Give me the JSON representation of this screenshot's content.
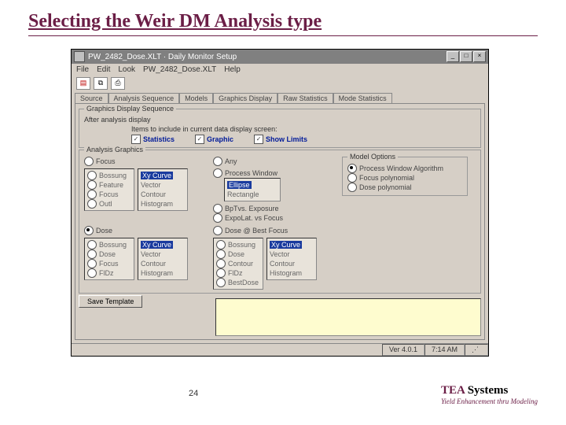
{
  "slide": {
    "title": "Selecting the Weir DM Analysis type",
    "page_number": "24"
  },
  "branding": {
    "company_tea": "TEA",
    "company_sys": " Systems",
    "tagline": "Yield Enhancement thru Modeling"
  },
  "window": {
    "title": "PW_2482_Dose.XLT · Daily Monitor Setup",
    "menu": {
      "file": "File",
      "edit": "Edit",
      "look": "Look",
      "doc": "PW_2482_Dose.XLT",
      "help": "Help"
    },
    "tabs": {
      "source": "Source",
      "analysis_sequence": "Analysis Sequence",
      "models": "Models",
      "graphics_display": "Graphics Display",
      "raw_statistics": "Raw Statistics",
      "mode_statistics": "Mode Statistics"
    },
    "gds": {
      "legend": "Graphics Display Sequence",
      "after_label": "After analysis display",
      "items_label": "Items to include in current data display screen:",
      "statistics": "Statistics",
      "graphic": "Graphic",
      "show_limits": "Show Limits"
    },
    "ag": {
      "legend": "Analysis Graphics",
      "focus": "Focus",
      "any": "Any",
      "list_bossung": "Bossung",
      "list_feature": "Feature",
      "list_focus": "Focus",
      "list_outl": "Outl",
      "vec_vector": "Vector",
      "vec_contour": "Contour",
      "vec_histogram": "Histogram",
      "xy_curve": "Xy Curve",
      "pw_label": "Process Window",
      "pw_ellipse": "Ellipse",
      "pw_rectangle": "Rectangle",
      "bp_label": "BpTvs. Exposure",
      "el_label": "ExpoLat. vs Focus",
      "model_legend": "Model Options",
      "model_pwa": "Process Window Algorithm",
      "model_fp": "Focus polynomial",
      "model_dp": "Dose polynomial",
      "dose": "Dose",
      "dose_best": "Dose @ Best Focus",
      "list2_bossung": "Bossung",
      "list2_dose": "Dose",
      "list2_focus": "Focus",
      "list2_fldz": "FlDz",
      "fl_bossung": "Bossung",
      "fl_dose": "Dose",
      "fl_contour": "Contour",
      "fl_fldz": "FlDz",
      "fl_bestdose": "BestDose",
      "save_template": "Save Template"
    },
    "status": {
      "version": "Ver 4.0.1",
      "time": "7:14 AM"
    }
  }
}
